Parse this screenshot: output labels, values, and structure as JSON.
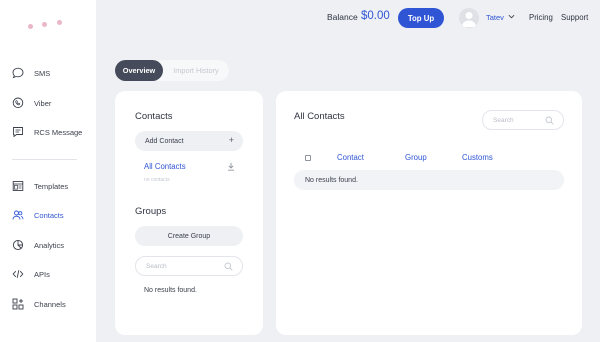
{
  "sidebar": {
    "items": [
      {
        "label": "SMS",
        "icon": "chat-bubble-icon"
      },
      {
        "label": "Viber",
        "icon": "phone-bubble-icon"
      },
      {
        "label": "RCS Message",
        "icon": "message-lines-icon"
      },
      {
        "label": "Templates",
        "icon": "template-icon"
      },
      {
        "label": "Contacts",
        "icon": "users-icon",
        "active": true
      },
      {
        "label": "Analytics",
        "icon": "pie-chart-icon"
      },
      {
        "label": "APIs",
        "icon": "code-icon"
      },
      {
        "label": "Channels",
        "icon": "grid-plus-icon"
      }
    ]
  },
  "header": {
    "balance_label": "Balance",
    "balance_value": "$0.00",
    "topup_label": "Top Up",
    "user_name": "Tatev",
    "pricing_label": "Pricing",
    "support_label": "Support"
  },
  "tabs": {
    "overview": "Overview",
    "import_history": "Import History"
  },
  "contacts_panel": {
    "title": "Contacts",
    "add_contact_label": "Add Contact",
    "add_icon_glyph": "+",
    "all_contacts_label": "All Contacts",
    "all_contacts_sub": "no contacts"
  },
  "groups_panel": {
    "title": "Groups",
    "create_group_label": "Create Group",
    "search_placeholder": "Search",
    "empty_text": "No results found."
  },
  "main_panel": {
    "title": "All Contacts",
    "search_placeholder": "Search",
    "columns": [
      "Contact",
      "Group",
      "Customs"
    ],
    "empty_text": "No results found."
  },
  "colors": {
    "accent": "#2f55d4",
    "background": "#eef0f4",
    "logo_dots": "#e9b7c6"
  }
}
